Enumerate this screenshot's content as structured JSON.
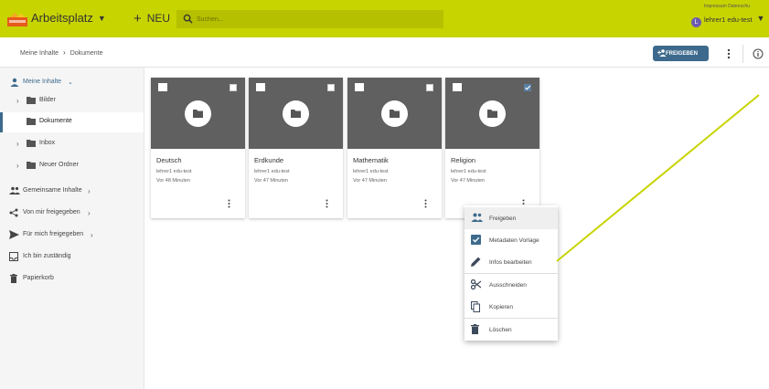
{
  "topbar": {
    "app_name": "Arbeitsplatz",
    "new_label": "NEU",
    "search_placeholder": "Suchen...",
    "top_links": "Impressum  Datenschu",
    "user_initial": "L",
    "user_name": "lehrer1 edu-test",
    "accent_color": "#c8d400"
  },
  "breadcrumb": {
    "root": "Meine Inhalte",
    "current": "Dokumente"
  },
  "toolbar": {
    "share_label": "FREIGEBEN"
  },
  "sidebar": {
    "items": [
      {
        "label": "Meine Inhalte",
        "icon": "person-icon"
      },
      {
        "label": "Bilder",
        "icon": "folder-icon"
      },
      {
        "label": "Dokumente",
        "icon": "folder-icon"
      },
      {
        "label": "Inbox",
        "icon": "folder-icon"
      },
      {
        "label": "Neuer Ordner",
        "icon": "folder-icon"
      },
      {
        "label": "Gemeinsame Inhalte",
        "icon": "group-icon"
      },
      {
        "label": "Von mir freigegeben",
        "icon": "share-icon"
      },
      {
        "label": "Für mich freigegeben",
        "icon": "send-icon"
      },
      {
        "label": "Ich bin zuständig",
        "icon": "inbox-icon"
      },
      {
        "label": "Papierkorb",
        "icon": "trash-icon"
      }
    ]
  },
  "cards": [
    {
      "title": "Deutsch",
      "owner": "lehrer1 edu-test",
      "time": "Vor 48 Minuten",
      "selected": false
    },
    {
      "title": "Erdkunde",
      "owner": "lehrer1 edu-test",
      "time": "Vor 47 Minuten",
      "selected": false
    },
    {
      "title": "Mathematik",
      "owner": "lehrer1 edu-test",
      "time": "Vor 47 Minuten",
      "selected": false
    },
    {
      "title": "Religion",
      "owner": "lehrer1 edu-test",
      "time": "Vor 47 Minuten",
      "selected": true
    }
  ],
  "context_menu": {
    "items": [
      {
        "label": "Freigeben",
        "icon": "share-user-icon"
      },
      {
        "label": "Metadaten Vorlage",
        "icon": "checkbox-icon"
      },
      {
        "label": "Infos bearbeiten",
        "icon": "pencil-icon"
      },
      {
        "label": "Ausschneiden",
        "icon": "scissors-icon"
      },
      {
        "label": "Kopieren",
        "icon": "copy-icon"
      },
      {
        "label": "Löschen",
        "icon": "trash-icon"
      }
    ]
  }
}
